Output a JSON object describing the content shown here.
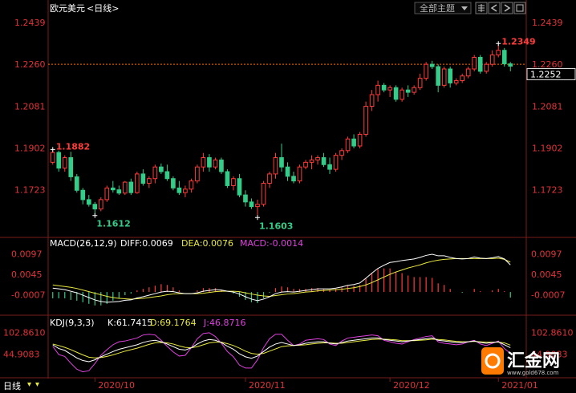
{
  "header": {
    "title": "欧元美元",
    "period": "<日线>",
    "theme_button": "全部主题",
    "colors": {
      "title": "#ffffff",
      "period": "#ffffff",
      "button_text": "#b8b8b8"
    }
  },
  "toolbar_icons": [
    "grid-icon",
    "scroll-left-icon",
    "scroll-right-icon",
    "expand-icon",
    "close-icon"
  ],
  "price_axis": {
    "ticks": [
      "1.2439",
      "1.2260",
      "1.2081",
      "1.1902",
      "1.1723"
    ],
    "current_label": "1.2252",
    "color_tick": "#e0333a"
  },
  "x_axis": {
    "ticks": [
      "2020/10",
      "2020/11",
      "2020/12",
      "2021/01"
    ]
  },
  "annotations": {
    "high": "1.2349",
    "start": "1.1882",
    "low1": "1.1612",
    "low2": "1.1603"
  },
  "macd_legend": {
    "label": "MACD(26,12,9)",
    "diff": "DIFF:0.0069",
    "dea": "DEA:0.0076",
    "macd": "MACD:-0.0014"
  },
  "macd_axis": [
    "0.0097",
    "0.0045",
    "-0.0007"
  ],
  "kdj_legend": {
    "label": "KDJ(9,3,3)",
    "k": "K:61.7415",
    "d": "D:69.1764",
    "j": "J:46.8716"
  },
  "kdj_axis": [
    "102.8610",
    "44.9083"
  ],
  "watermark": {
    "brand": "汇金网",
    "url": "www.gold678.com"
  },
  "colors": {
    "up": "#ff3b3b",
    "down": "#33cc88",
    "diff_line": "#ffffff",
    "dea_line": "#e8e840",
    "macd_text": "#e040e0",
    "k_line": "#ffffff",
    "d_line": "#e8e840",
    "j_line": "#e040e0",
    "grid": "#7a1c1c",
    "dotted": "#ff6a00"
  },
  "chart_data": {
    "type": "candlestick",
    "ylim": [
      1.158,
      1.246
    ],
    "candles": [
      [
        1.184,
        1.1895,
        1.183,
        1.1882
      ],
      [
        1.1882,
        1.189,
        1.18,
        1.1815
      ],
      [
        1.1815,
        1.187,
        1.18,
        1.186
      ],
      [
        1.186,
        1.1885,
        1.176,
        1.1778
      ],
      [
        1.1778,
        1.179,
        1.171,
        1.172
      ],
      [
        1.172,
        1.173,
        1.166,
        1.168
      ],
      [
        1.168,
        1.17,
        1.165,
        1.166
      ],
      [
        1.166,
        1.167,
        1.1612,
        1.164
      ],
      [
        1.164,
        1.169,
        1.163,
        1.168
      ],
      [
        1.168,
        1.174,
        1.167,
        1.173
      ],
      [
        1.173,
        1.176,
        1.171,
        1.1722
      ],
      [
        1.1722,
        1.174,
        1.17,
        1.1708
      ],
      [
        1.1708,
        1.176,
        1.17,
        1.1755
      ],
      [
        1.1755,
        1.177,
        1.17,
        1.171
      ],
      [
        1.171,
        1.18,
        1.1705,
        1.179
      ],
      [
        1.179,
        1.181,
        1.174,
        1.175
      ],
      [
        1.175,
        1.178,
        1.173,
        1.177
      ],
      [
        1.177,
        1.183,
        1.175,
        1.182
      ],
      [
        1.182,
        1.1835,
        1.179,
        1.18
      ],
      [
        1.18,
        1.183,
        1.176,
        1.177
      ],
      [
        1.177,
        1.178,
        1.172,
        1.173
      ],
      [
        1.173,
        1.176,
        1.17,
        1.171
      ],
      [
        1.171,
        1.174,
        1.169,
        1.1725
      ],
      [
        1.1725,
        1.177,
        1.171,
        1.176
      ],
      [
        1.176,
        1.183,
        1.175,
        1.182
      ],
      [
        1.182,
        1.188,
        1.18,
        1.186
      ],
      [
        1.186,
        1.1875,
        1.18,
        1.182
      ],
      [
        1.182,
        1.186,
        1.181,
        1.185
      ],
      [
        1.185,
        1.186,
        1.179,
        1.18
      ],
      [
        1.18,
        1.181,
        1.173,
        1.174
      ],
      [
        1.174,
        1.178,
        1.172,
        1.177
      ],
      [
        1.177,
        1.179,
        1.169,
        1.17
      ],
      [
        1.17,
        1.172,
        1.165,
        1.167
      ],
      [
        1.167,
        1.1685,
        1.164,
        1.165
      ],
      [
        1.165,
        1.168,
        1.1603,
        1.166
      ],
      [
        1.166,
        1.176,
        1.165,
        1.175
      ],
      [
        1.175,
        1.18,
        1.173,
        1.179
      ],
      [
        1.179,
        1.188,
        1.177,
        1.186
      ],
      [
        1.186,
        1.192,
        1.18,
        1.182
      ],
      [
        1.182,
        1.184,
        1.176,
        1.178
      ],
      [
        1.178,
        1.18,
        1.175,
        1.176
      ],
      [
        1.176,
        1.183,
        1.175,
        1.182
      ],
      [
        1.182,
        1.185,
        1.181,
        1.184
      ],
      [
        1.184,
        1.187,
        1.181,
        1.185
      ],
      [
        1.185,
        1.187,
        1.183,
        1.186
      ],
      [
        1.186,
        1.188,
        1.182,
        1.183
      ],
      [
        1.183,
        1.186,
        1.179,
        1.181
      ],
      [
        1.181,
        1.188,
        1.18,
        1.187
      ],
      [
        1.187,
        1.19,
        1.185,
        1.189
      ],
      [
        1.189,
        1.195,
        1.188,
        1.194
      ],
      [
        1.194,
        1.196,
        1.19,
        1.191
      ],
      [
        1.191,
        1.197,
        1.19,
        1.196
      ],
      [
        1.196,
        1.21,
        1.195,
        1.208
      ],
      [
        1.208,
        1.215,
        1.206,
        1.213
      ],
      [
        1.213,
        1.219,
        1.21,
        1.217
      ],
      [
        1.217,
        1.218,
        1.214,
        1.215
      ],
      [
        1.215,
        1.217,
        1.212,
        1.216
      ],
      [
        1.216,
        1.217,
        1.21,
        1.211
      ],
      [
        1.211,
        1.216,
        1.21,
        1.215
      ],
      [
        1.215,
        1.217,
        1.212,
        1.214
      ],
      [
        1.214,
        1.217,
        1.213,
        1.216
      ],
      [
        1.216,
        1.222,
        1.215,
        1.22
      ],
      [
        1.22,
        1.227,
        1.219,
        1.226
      ],
      [
        1.226,
        1.2275,
        1.224,
        1.225
      ],
      [
        1.225,
        1.226,
        1.214,
        1.217
      ],
      [
        1.217,
        1.225,
        1.216,
        1.224
      ],
      [
        1.224,
        1.225,
        1.216,
        1.218
      ],
      [
        1.218,
        1.22,
        1.217,
        1.219
      ],
      [
        1.219,
        1.222,
        1.218,
        1.221
      ],
      [
        1.221,
        1.225,
        1.22,
        1.224
      ],
      [
        1.224,
        1.23,
        1.223,
        1.229
      ],
      [
        1.229,
        1.23,
        1.222,
        1.223
      ],
      [
        1.223,
        1.227,
        1.222,
        1.226
      ],
      [
        1.226,
        1.232,
        1.225,
        1.23
      ],
      [
        1.23,
        1.2349,
        1.229,
        1.232
      ],
      [
        1.232,
        1.233,
        1.225,
        1.2262
      ],
      [
        1.2262,
        1.227,
        1.223,
        1.2252
      ]
    ],
    "macd": {
      "diff": [
        0.001,
        0.0008,
        0.0006,
        0.0002,
        -0.0002,
        -0.0008,
        -0.0014,
        -0.002,
        -0.0024,
        -0.0026,
        -0.0025,
        -0.0024,
        -0.0021,
        -0.002,
        -0.0015,
        -0.0012,
        -0.0008,
        -0.0004,
        0.0,
        0.0002,
        0.0001,
        -0.0002,
        -0.0004,
        -0.0004,
        -0.0002,
        0.0002,
        0.0004,
        0.0006,
        0.0005,
        0.0002,
        0.0,
        -0.0005,
        -0.0012,
        -0.0018,
        -0.0022,
        -0.0018,
        -0.0012,
        -0.0004,
        0.0,
        0.0001,
        0.0,
        0.0002,
        0.0004,
        0.0006,
        0.0008,
        0.0008,
        0.0008,
        0.001,
        0.0013,
        0.0017,
        0.0019,
        0.0023,
        0.0035,
        0.0048,
        0.006,
        0.0068,
        0.0075,
        0.0077,
        0.008,
        0.0082,
        0.0084,
        0.0088,
        0.0093,
        0.0096,
        0.0092,
        0.0092,
        0.0088,
        0.0085,
        0.0084,
        0.0085,
        0.0089,
        0.0086,
        0.0085,
        0.0087,
        0.009,
        0.0084,
        0.0069
      ],
      "dea": [
        0.0018,
        0.0016,
        0.0014,
        0.0012,
        0.0009,
        0.0005,
        0.0001,
        -0.0003,
        -0.0007,
        -0.0011,
        -0.0014,
        -0.0016,
        -0.0017,
        -0.0018,
        -0.0017,
        -0.0016,
        -0.0014,
        -0.0012,
        -0.001,
        -0.0007,
        -0.0005,
        -0.0004,
        -0.0004,
        -0.0004,
        -0.0004,
        -0.0003,
        -0.0001,
        0.0001,
        0.0002,
        0.0002,
        0.0002,
        0.0001,
        -0.0002,
        -0.0005,
        -0.0008,
        -0.001,
        -0.0011,
        -0.0009,
        -0.0007,
        -0.0005,
        -0.0004,
        -0.0002,
        0.0,
        0.0001,
        0.0003,
        0.0004,
        0.0005,
        0.0006,
        0.0007,
        0.0009,
        0.0011,
        0.0014,
        0.0018,
        0.0024,
        0.0031,
        0.0038,
        0.0045,
        0.0051,
        0.0056,
        0.0061,
        0.0065,
        0.0069,
        0.0074,
        0.0078,
        0.0081,
        0.0083,
        0.0084,
        0.0085,
        0.0085,
        0.0085,
        0.0085,
        0.0085,
        0.0085,
        0.0085,
        0.0086,
        0.0083,
        0.0076
      ]
    },
    "kdj": {
      "k": [
        70,
        60,
        55,
        45,
        35,
        28,
        25,
        30,
        38,
        45,
        52,
        58,
        62,
        66,
        70,
        76,
        80,
        82,
        78,
        72,
        65,
        58,
        56,
        62,
        72,
        80,
        84,
        82,
        76,
        66,
        58,
        46,
        38,
        34,
        40,
        52,
        64,
        72,
        76,
        72,
        68,
        70,
        74,
        76,
        78,
        78,
        74,
        72,
        76,
        80,
        82,
        84,
        86,
        88,
        88,
        84,
        82,
        80,
        78,
        80,
        82,
        84,
        86,
        88,
        82,
        80,
        78,
        76,
        76,
        78,
        80,
        76,
        74,
        76,
        78,
        70,
        62
      ],
      "d": [
        72,
        68,
        63,
        57,
        50,
        43,
        37,
        35,
        36,
        39,
        43,
        48,
        53,
        57,
        61,
        66,
        71,
        75,
        76,
        75,
        72,
        67,
        63,
        62,
        65,
        70,
        75,
        77,
        77,
        73,
        68,
        61,
        53,
        47,
        45,
        47,
        53,
        59,
        65,
        67,
        68,
        69,
        70,
        72,
        74,
        75,
        75,
        74,
        74,
        76,
        78,
        80,
        82,
        84,
        85,
        85,
        84,
        83,
        81,
        81,
        81,
        82,
        83,
        85,
        84,
        83,
        81,
        79,
        78,
        78,
        79,
        78,
        77,
        77,
        77,
        75,
        69
      ],
      "j": [
        66,
        44,
        39,
        21,
        5,
        -2,
        1,
        20,
        42,
        57,
        70,
        78,
        80,
        84,
        88,
        96,
        98,
        96,
        82,
        66,
        51,
        40,
        42,
        62,
        86,
        100,
        102,
        92,
        74,
        52,
        38,
        16,
        8,
        8,
        30,
        62,
        86,
        98,
        98,
        82,
        68,
        72,
        82,
        84,
        86,
        84,
        72,
        68,
        80,
        88,
        90,
        92,
        94,
        96,
        94,
        82,
        78,
        74,
        72,
        78,
        84,
        88,
        92,
        94,
        78,
        74,
        72,
        70,
        72,
        78,
        82,
        72,
        68,
        74,
        80,
        60,
        47
      ]
    },
    "x_tick_indices": [
      7,
      32,
      56,
      74
    ]
  }
}
